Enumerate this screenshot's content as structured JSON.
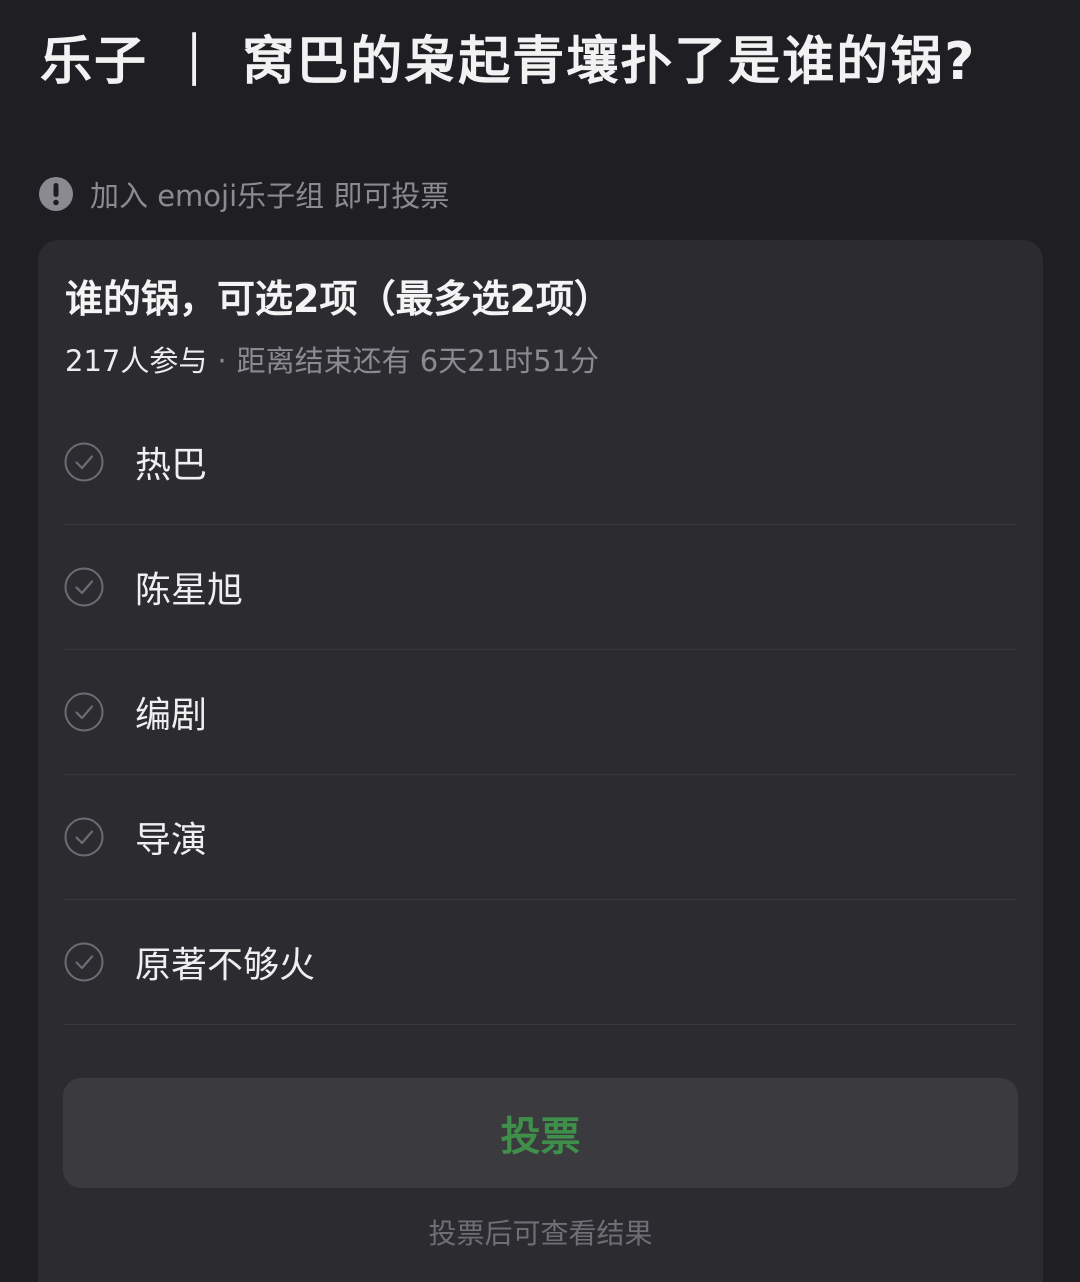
{
  "header": {
    "title": "乐子 ｜ 窝巴的枭起青壤扑了是谁的锅?"
  },
  "notice": {
    "icon": "exclamation-circle-icon",
    "text": "加入 emoji乐子组 即可投票"
  },
  "poll": {
    "question": "谁的锅，可选2项（最多选2项）",
    "participants": "217人参与",
    "separator": "·",
    "remaining": "距离结束还有 6天21时51分",
    "options": [
      {
        "label": "热巴"
      },
      {
        "label": "陈星旭"
      },
      {
        "label": "编剧"
      },
      {
        "label": "导演"
      },
      {
        "label": "原著不够火"
      }
    ],
    "vote_label": "投票",
    "hint": "投票后可查看结果"
  },
  "colors": {
    "background": "#1f1f23",
    "card": "#2b2b30",
    "vote_text": "#3f8f4a",
    "muted": "#8a8a90"
  }
}
